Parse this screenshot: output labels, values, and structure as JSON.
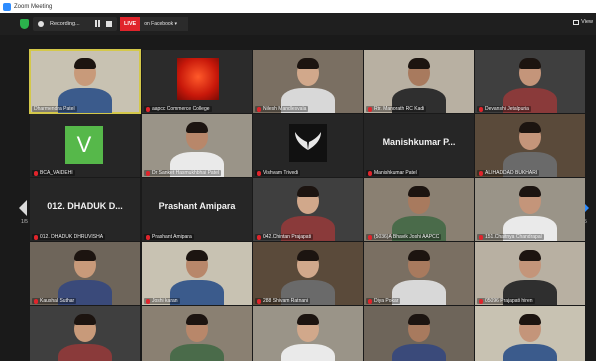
{
  "window": {
    "title": "Zoom Meeting"
  },
  "toolbar": {
    "recording_label": "Recording...",
    "live_badge": "LIVE",
    "live_platform": "on Facebook",
    "view_label": "View"
  },
  "pagination": {
    "left": "1/5",
    "right": "1/5"
  },
  "tiles": [
    {
      "name": "Dharmendra Patel",
      "big": ""
    },
    {
      "name": "aapcc Commerce College",
      "big": ""
    },
    {
      "name": "Nilesh Mandlesvala",
      "big": ""
    },
    {
      "name": "Rtr. Manorath RC Kadi",
      "big": ""
    },
    {
      "name": "Devanshi Jetalpuria",
      "big": ""
    },
    {
      "name": "BCA_VAIDEHI",
      "big": ""
    },
    {
      "name": "Dr Sanket Hasmukhbhai Patel",
      "big": ""
    },
    {
      "name": "Vishvam Trivedi",
      "big": ""
    },
    {
      "name": "Manishkumar Patel",
      "big": "Manishkumar P..."
    },
    {
      "name": "ALIHADDAD BUKHARI",
      "big": ""
    },
    {
      "name": "012. DHADUK DHRUVISHA",
      "big": "012. DHADUK D..."
    },
    {
      "name": "Prashant Amipara",
      "big": "Prashant Amipara"
    },
    {
      "name": "042.Chintan Prajapati",
      "big": ""
    },
    {
      "name": "(5036)A Bhavik Joshi AAPCC",
      "big": ""
    },
    {
      "name": "151.Chaitnya Chandrapal",
      "big": ""
    },
    {
      "name": "Kaushal Suthar",
      "big": ""
    },
    {
      "name": "Joshi karan",
      "big": ""
    },
    {
      "name": "288 Shivam Ratnani",
      "big": ""
    },
    {
      "name": "Diya Pokar",
      "big": ""
    },
    {
      "name": "05096 Prajapati hiren",
      "big": ""
    },
    {
      "name": "",
      "big": ""
    },
    {
      "name": "",
      "big": ""
    },
    {
      "name": "",
      "big": ""
    },
    {
      "name": "",
      "big": ""
    },
    {
      "name": "",
      "big": ""
    }
  ],
  "avatar_letter": "V"
}
